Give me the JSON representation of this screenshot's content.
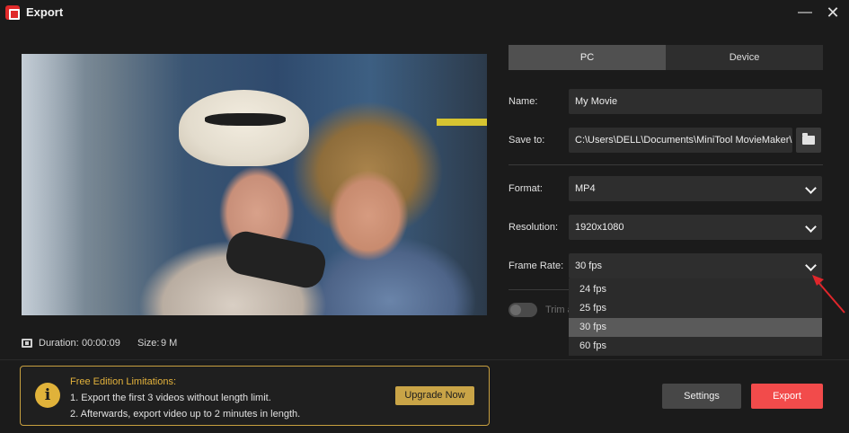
{
  "window": {
    "title": "Export",
    "minimize_glyph": "—",
    "close_glyph": "✕"
  },
  "preview": {
    "duration_label": "Duration:",
    "duration_value": "00:00:09",
    "size_label": "Size:",
    "size_value": "9 M"
  },
  "tabs": [
    {
      "label": "PC",
      "active": true
    },
    {
      "label": "Device",
      "active": false
    }
  ],
  "form": {
    "name_label": "Name:",
    "name_value": "My Movie",
    "save_to_label": "Save to:",
    "save_to_value": "C:\\Users\\DELL\\Documents\\MiniTool MovieMaker\\out",
    "format_label": "Format:",
    "format_value": "MP4",
    "resolution_label": "Resolution:",
    "resolution_value": "1920x1080",
    "frame_rate_label": "Frame Rate:",
    "frame_rate_value": "30 fps",
    "trim_label": "Trim a"
  },
  "frame_rate_options": [
    {
      "label": "24 fps",
      "selected": false
    },
    {
      "label": "25 fps",
      "selected": false
    },
    {
      "label": "30 fps",
      "selected": true
    },
    {
      "label": "60 fps",
      "selected": false
    }
  ],
  "limitations": {
    "title": "Free Edition Limitations:",
    "line1": "1. Export the first 3 videos without length limit.",
    "line2": "2. Afterwards, export video up to 2 minutes in length.",
    "upgrade_label": "Upgrade Now",
    "info_glyph": "i"
  },
  "actions": {
    "settings_label": "Settings",
    "export_label": "Export"
  },
  "colors": {
    "accent_export": "#f24b4b",
    "upgrade_gold": "#c9a447",
    "annotation_arrow": "#e0262b"
  }
}
